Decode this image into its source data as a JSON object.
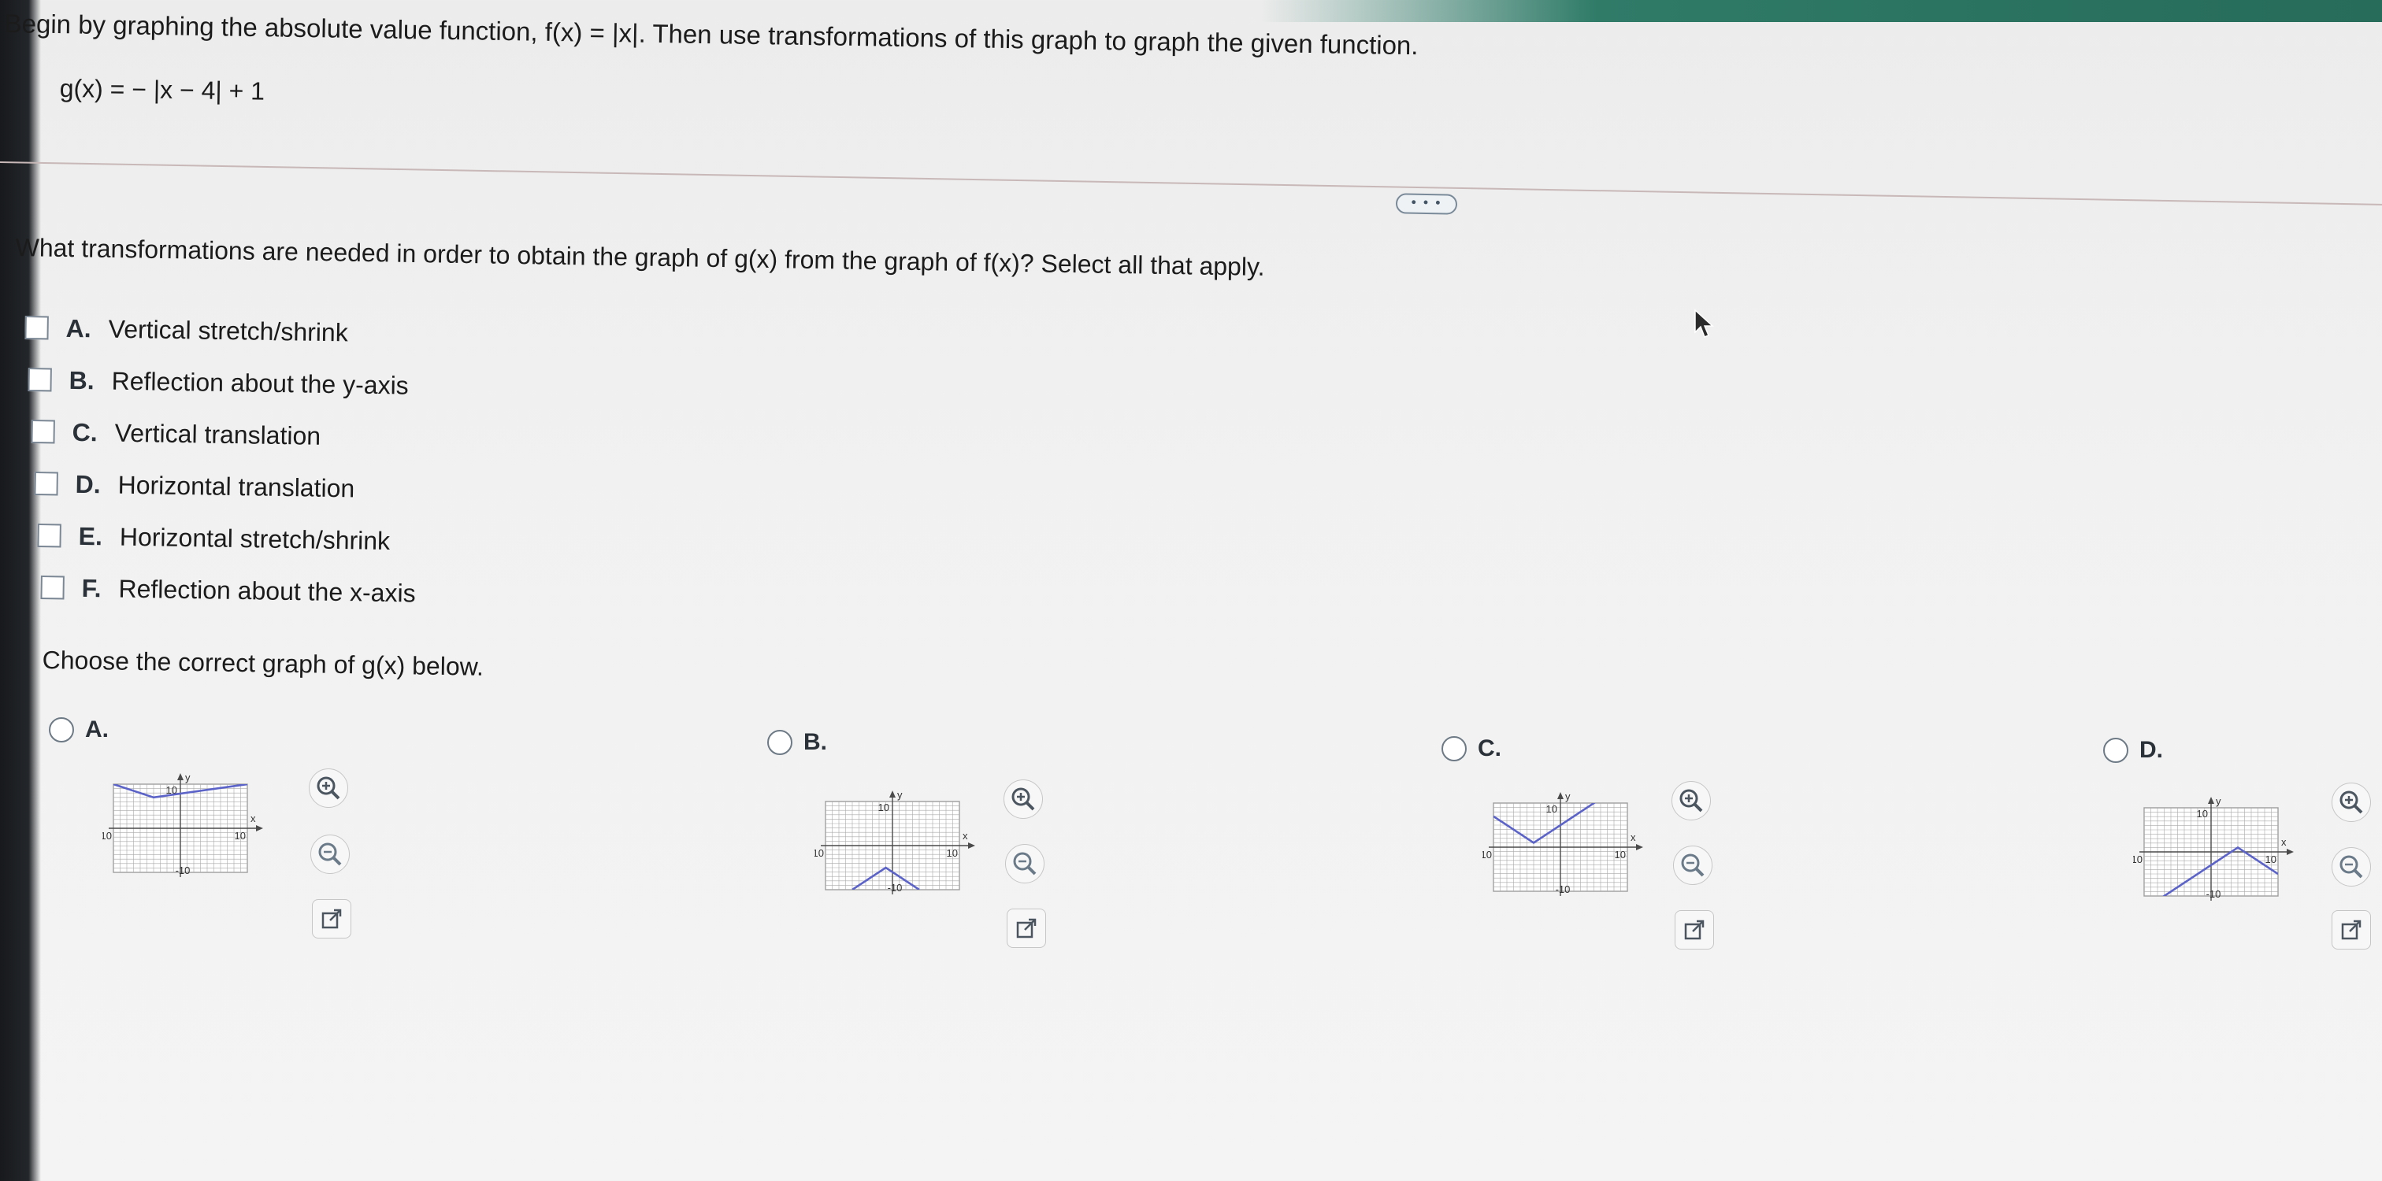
{
  "prompt": {
    "text": "Begin by graphing the absolute value function, f(x) = |x|. Then use transformations of this graph to graph the given function.",
    "function": "g(x) = − |x − 4| + 1"
  },
  "more_button": "• • •",
  "question": "What transformations are needed in order to obtain the graph of g(x) from the graph of f(x)? Select all that apply.",
  "options": [
    {
      "letter": "A.",
      "label": "Vertical stretch/shrink",
      "checked": false
    },
    {
      "letter": "B.",
      "label": "Reflection about the y-axis",
      "checked": false
    },
    {
      "letter": "C.",
      "label": "Vertical translation",
      "checked": false
    },
    {
      "letter": "D.",
      "label": "Horizontal translation",
      "checked": false
    },
    {
      "letter": "E.",
      "label": "Horizontal stretch/shrink",
      "checked": false
    },
    {
      "letter": "F.",
      "label": "Reflection about the x-axis",
      "checked": false
    }
  ],
  "choose_prompt": "Choose the correct graph of g(x) below.",
  "graph_choices": [
    {
      "letter": "A.",
      "selected": false
    },
    {
      "letter": "B.",
      "selected": false
    },
    {
      "letter": "C.",
      "selected": false
    },
    {
      "letter": "D.",
      "selected": false
    }
  ],
  "graph_axes": {
    "x_label": "x",
    "y_label": "y",
    "max_label": "10",
    "min_label": "-10"
  },
  "tool_icons": [
    "zoom-in-icon",
    "zoom-out-icon",
    "new-window-icon"
  ],
  "chart_data": [
    {
      "type": "line",
      "choice": "A.",
      "x": [
        -10,
        -4,
        10
      ],
      "y": [
        10,
        7,
        10
      ],
      "xlim": [
        -10,
        10
      ],
      "ylim": [
        -10,
        10
      ],
      "xlabel": "x",
      "ylabel": "y",
      "grid": true,
      "color": "#5b63c9"
    },
    {
      "type": "line",
      "choice": "B.",
      "x": [
        -6,
        -1,
        4
      ],
      "y": [
        -10,
        -5,
        -10
      ],
      "xlim": [
        -10,
        10
      ],
      "ylim": [
        -10,
        10
      ],
      "xlabel": "x",
      "ylabel": "y",
      "grid": true,
      "color": "#5b63c9"
    },
    {
      "type": "line",
      "choice": "C.",
      "x": [
        -10,
        -4,
        10
      ],
      "y": [
        7,
        1,
        15
      ],
      "xlim": [
        -10,
        10
      ],
      "ylim": [
        -10,
        10
      ],
      "xlabel": "x",
      "ylabel": "y",
      "grid": true,
      "color": "#5b63c9"
    },
    {
      "type": "line",
      "choice": "D.",
      "x": [
        -8,
        4,
        10
      ],
      "y": [
        -11,
        1,
        -5
      ],
      "xlim": [
        -10,
        10
      ],
      "ylim": [
        -10,
        10
      ],
      "xlabel": "x",
      "ylabel": "y",
      "grid": true,
      "color": "#5b63c9"
    }
  ],
  "colors": {
    "accent": "#2f7b68",
    "graph_line": "#5b63c9",
    "grid": "#a9a9a9"
  }
}
